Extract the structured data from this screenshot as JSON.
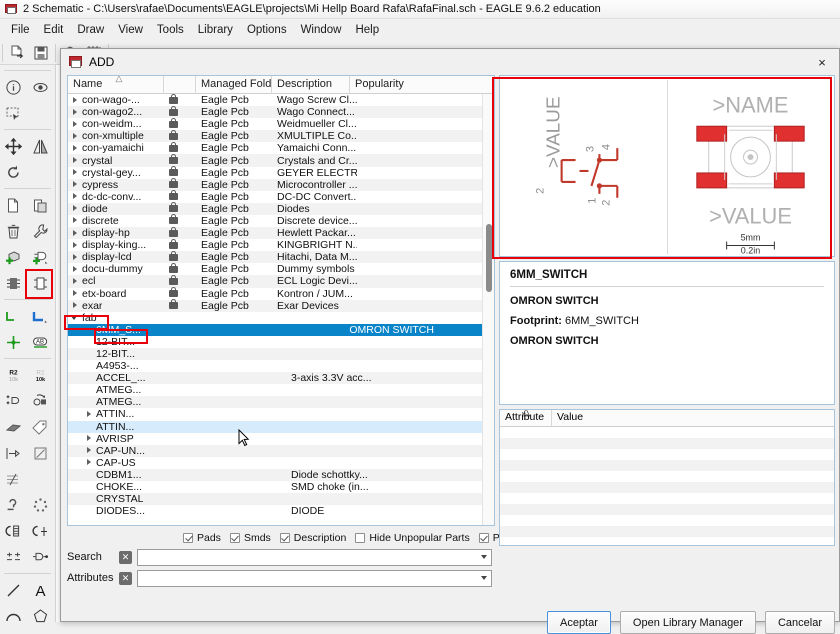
{
  "window": {
    "title": "2 Schematic - C:\\Users\\rafae\\Documents\\EAGLE\\projects\\Mi Hellp Board Rafa\\RafaFinal.sch - EAGLE 9.6.2 education",
    "icon": "eagle-app-icon"
  },
  "menubar": {
    "items": [
      "File",
      "Edit",
      "Draw",
      "View",
      "Tools",
      "Library",
      "Options",
      "Window",
      "Help"
    ]
  },
  "dialog": {
    "title": "ADD",
    "close_label": "×",
    "columns": [
      "Name",
      "",
      "Managed Folder",
      "Description",
      "Popularity"
    ],
    "rows": [
      {
        "name": "con-wago-...",
        "indent": 0,
        "arrow": "closed",
        "lock": true,
        "folder": "Eagle Pcb",
        "desc": "Wago Screw Cl...",
        "pop": ""
      },
      {
        "name": "con-wago2...",
        "indent": 0,
        "arrow": "closed",
        "lock": true,
        "folder": "Eagle Pcb",
        "desc": "Wago Connect...",
        "pop": ""
      },
      {
        "name": "con-weidm...",
        "indent": 0,
        "arrow": "closed",
        "lock": true,
        "folder": "Eagle Pcb",
        "desc": "Weidmueller Cl...",
        "pop": ""
      },
      {
        "name": "con-xmultiple",
        "indent": 0,
        "arrow": "closed",
        "lock": true,
        "folder": "Eagle Pcb",
        "desc": "XMULTIPLE Co...",
        "pop": ""
      },
      {
        "name": "con-yamaichi",
        "indent": 0,
        "arrow": "closed",
        "lock": true,
        "folder": "Eagle Pcb",
        "desc": "Yamaichi Conn...",
        "pop": ""
      },
      {
        "name": "crystal",
        "indent": 0,
        "arrow": "closed",
        "lock": true,
        "folder": "Eagle Pcb",
        "desc": "Crystals and Cr...",
        "pop": ""
      },
      {
        "name": "crystal-gey...",
        "indent": 0,
        "arrow": "closed",
        "lock": true,
        "folder": "Eagle Pcb",
        "desc": "GEYER ELECTR...",
        "pop": ""
      },
      {
        "name": "cypress",
        "indent": 0,
        "arrow": "closed",
        "lock": true,
        "folder": "Eagle Pcb",
        "desc": "Microcontroller ...",
        "pop": ""
      },
      {
        "name": "dc-dc-conv...",
        "indent": 0,
        "arrow": "closed",
        "lock": true,
        "folder": "Eagle Pcb",
        "desc": "DC-DC Convert...",
        "pop": ""
      },
      {
        "name": "diode",
        "indent": 0,
        "arrow": "closed",
        "lock": true,
        "folder": "Eagle Pcb",
        "desc": "Diodes",
        "pop": ""
      },
      {
        "name": "discrete",
        "indent": 0,
        "arrow": "closed",
        "lock": true,
        "folder": "Eagle Pcb",
        "desc": "Discrete device...",
        "pop": ""
      },
      {
        "name": "display-hp",
        "indent": 0,
        "arrow": "closed",
        "lock": true,
        "folder": "Eagle Pcb",
        "desc": "Hewlett Packar...",
        "pop": ""
      },
      {
        "name": "display-king...",
        "indent": 0,
        "arrow": "closed",
        "lock": true,
        "folder": "Eagle Pcb",
        "desc": "KINGBRIGHT N...",
        "pop": ""
      },
      {
        "name": "display-lcd",
        "indent": 0,
        "arrow": "closed",
        "lock": true,
        "folder": "Eagle Pcb",
        "desc": "Hitachi, Data M...",
        "pop": ""
      },
      {
        "name": "docu-dummy",
        "indent": 0,
        "arrow": "closed",
        "lock": true,
        "folder": "Eagle Pcb",
        "desc": "Dummy symbols",
        "pop": ""
      },
      {
        "name": "ecl",
        "indent": 0,
        "arrow": "closed",
        "lock": true,
        "folder": "Eagle Pcb",
        "desc": "ECL Logic Devi...",
        "pop": ""
      },
      {
        "name": "etx-board",
        "indent": 0,
        "arrow": "closed",
        "lock": true,
        "folder": "Eagle Pcb",
        "desc": "Kontron / JUM...",
        "pop": ""
      },
      {
        "name": "exar",
        "indent": 0,
        "arrow": "closed",
        "lock": true,
        "folder": "Eagle Pcb",
        "desc": "Exar Devices",
        "pop": ""
      },
      {
        "name": "fab",
        "indent": 0,
        "arrow": "open",
        "lock": false,
        "folder": "",
        "desc": "",
        "pop": ""
      },
      {
        "name": "6MM_S...",
        "indent": 1,
        "arrow": "none",
        "lock": false,
        "folder": "",
        "desc": "OMRON SWITCH",
        "pop": "",
        "selected": true
      },
      {
        "name": "12-BIT...",
        "indent": 1,
        "arrow": "none",
        "lock": false,
        "folder": "",
        "desc": "",
        "pop": ""
      },
      {
        "name": "12-BIT...",
        "indent": 1,
        "arrow": "none",
        "lock": false,
        "folder": "",
        "desc": "",
        "pop": ""
      },
      {
        "name": "A4953-...",
        "indent": 1,
        "arrow": "none",
        "lock": false,
        "folder": "",
        "desc": "",
        "pop": ""
      },
      {
        "name": "ACCEL_...",
        "indent": 1,
        "arrow": "none",
        "lock": false,
        "folder": "",
        "desc": "3-axis 3.3V acc...",
        "pop": ""
      },
      {
        "name": "ATMEG...",
        "indent": 1,
        "arrow": "none",
        "lock": false,
        "folder": "",
        "desc": "",
        "pop": ""
      },
      {
        "name": "ATMEG...",
        "indent": 1,
        "arrow": "none",
        "lock": false,
        "folder": "",
        "desc": "",
        "pop": ""
      },
      {
        "name": "ATTIN...",
        "indent": 1,
        "arrow": "closed",
        "lock": false,
        "folder": "",
        "desc": "",
        "pop": ""
      },
      {
        "name": "ATTIN...",
        "indent": 1,
        "arrow": "none",
        "lock": false,
        "folder": "",
        "desc": "",
        "pop": "",
        "hover": true
      },
      {
        "name": "AVRISP",
        "indent": 1,
        "arrow": "closed",
        "lock": false,
        "folder": "",
        "desc": "",
        "pop": ""
      },
      {
        "name": "CAP-UN...",
        "indent": 1,
        "arrow": "closed",
        "lock": false,
        "folder": "",
        "desc": "",
        "pop": ""
      },
      {
        "name": "CAP-US",
        "indent": 1,
        "arrow": "closed",
        "lock": false,
        "folder": "",
        "desc": "",
        "pop": ""
      },
      {
        "name": "CDBM1...",
        "indent": 1,
        "arrow": "none",
        "lock": false,
        "folder": "",
        "desc": "Diode schottky...",
        "pop": ""
      },
      {
        "name": "CHOKE...",
        "indent": 1,
        "arrow": "none",
        "lock": false,
        "folder": "",
        "desc": "SMD choke (in...",
        "pop": ""
      },
      {
        "name": "CRYSTAL",
        "indent": 1,
        "arrow": "none",
        "lock": false,
        "folder": "",
        "desc": "",
        "pop": ""
      },
      {
        "name": "DIODES...",
        "indent": 1,
        "arrow": "none",
        "lock": false,
        "folder": "",
        "desc": "DIODE",
        "pop": ""
      }
    ],
    "options": [
      {
        "label": "Pads",
        "checked": true
      },
      {
        "label": "Smds",
        "checked": true
      },
      {
        "label": "Description",
        "checked": true
      },
      {
        "label": "Hide Unpopular Parts",
        "checked": false
      },
      {
        "label": "Preview",
        "checked": true
      }
    ],
    "search": {
      "label": "Search",
      "value": "",
      "placeholder": "",
      "clear": "✕"
    },
    "attributes_field": {
      "label": "Attributes",
      "value": "",
      "placeholder": "",
      "clear": "✕"
    },
    "preview": {
      "symbol": {
        "value_text": ">VALUE",
        "pin_labels": [
          "1",
          "2",
          "3",
          "4"
        ],
        "side_label": "2"
      },
      "footprint": {
        "name_text": ">NAME",
        "value_text": ">VALUE",
        "scale_mm": "5mm",
        "scale_in": "0.2in",
        "pad_color": "#e03030"
      }
    },
    "details": {
      "title": "6MM_SWITCH",
      "subtitle": "OMRON SWITCH",
      "footprint_label": "Footprint:",
      "footprint_value": "6MM_SWITCH",
      "body": "OMRON SWITCH"
    },
    "attributes_table": {
      "columns": [
        "Attribute",
        "Value"
      ],
      "rows": []
    },
    "buttons": [
      {
        "label": "Aceptar",
        "primary": true
      },
      {
        "label": "Open Library Manager",
        "primary": false
      },
      {
        "label": "Cancelar",
        "primary": false
      }
    ]
  },
  "annotations": {
    "color": "#e8000a",
    "count": 4
  }
}
